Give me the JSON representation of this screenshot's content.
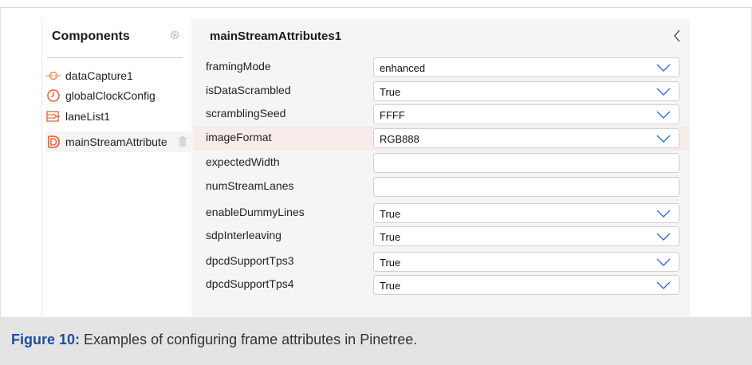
{
  "components": {
    "header": "Components",
    "items": [
      {
        "label": "dataCapture1",
        "icon": "data-capture-icon"
      },
      {
        "label": "globalClockConfig",
        "icon": "clock-icon"
      },
      {
        "label": "laneList1",
        "icon": "lane-list-icon"
      },
      {
        "label": "mainStreamAttribute",
        "icon": "stream-attributes-icon",
        "selected": true
      }
    ]
  },
  "attributes": {
    "title": "mainStreamAttributes1",
    "rows": [
      {
        "label": "framingMode",
        "value": "enhanced",
        "dropdown": true
      },
      {
        "label": "isDataScrambled",
        "value": "True",
        "dropdown": true
      },
      {
        "label": "scramblingSeed",
        "value": "FFFF",
        "dropdown": true
      },
      {
        "label": "imageFormat",
        "value": "RGB888",
        "dropdown": true,
        "highlighted": true
      },
      {
        "label": "expectedWidth",
        "value": "",
        "dropdown": false
      },
      {
        "label": "numStreamLanes",
        "value": "",
        "dropdown": false
      },
      {
        "label": "enableDummyLines",
        "value": "True",
        "dropdown": true
      },
      {
        "label": "sdpInterleaving",
        "value": "True",
        "dropdown": true
      },
      {
        "label": "dpcdSupportTps3",
        "value": "True",
        "dropdown": true
      },
      {
        "label": "dpcdSupportTps4",
        "value": "True",
        "dropdown": true
      }
    ]
  },
  "caption": {
    "figure_label": "Figure 10:",
    "text": " Examples of configuring frame attributes in Pinetree."
  },
  "colors": {
    "accent": "#1a4f9c",
    "chevron": "#2f6fd6",
    "selected_icon": "#e4572e",
    "highlight_row": "#f8ecea"
  }
}
